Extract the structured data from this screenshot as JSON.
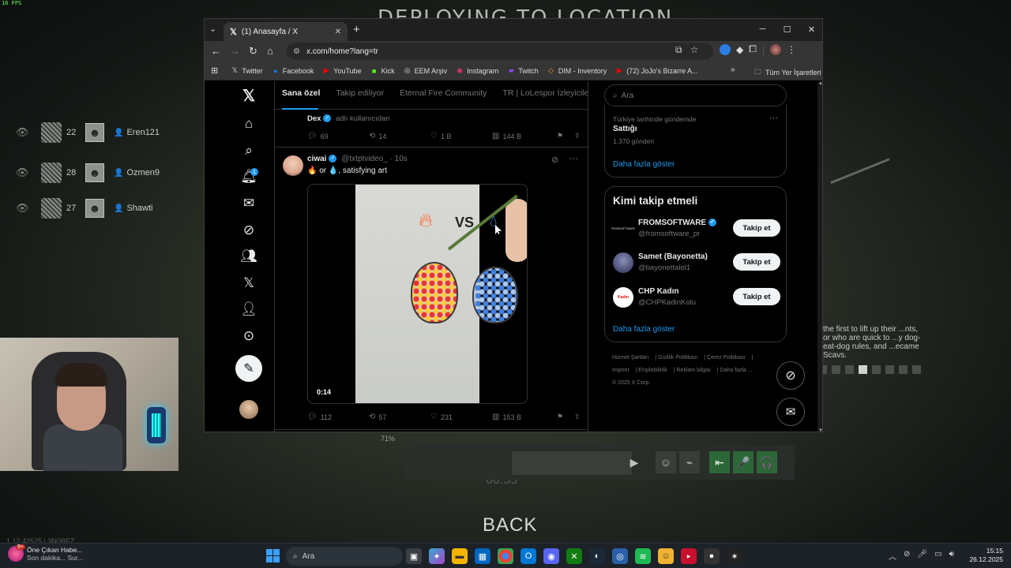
{
  "game": {
    "title": "DEPLOYING TO LOCATION",
    "fps": "16 FPS",
    "back_label": "BACK",
    "timer_ghost": "00:55",
    "squad": [
      {
        "level": "22",
        "name": "Eren121"
      },
      {
        "level": "28",
        "name": "Ozmen9"
      },
      {
        "level": "27",
        "name": "Shawti"
      }
    ],
    "scav_text": "the first to lift up their ...nts, or who are quick to ...y dog-eat-dog rules, and ...ecame Scavs.",
    "voice_pct": "71%",
    "bottom_left_ghost": "1.12.42525 | 3N0RFZ"
  },
  "browser": {
    "tab_title": "(1) Anasayfa / X",
    "url": "x.com/home?lang=tr",
    "bookmarks": [
      {
        "icon": "x-icon",
        "label": "Twitter"
      },
      {
        "icon": "facebook-icon",
        "label": "Facebook"
      },
      {
        "icon": "youtube-icon",
        "label": "YouTube"
      },
      {
        "icon": "kick-icon",
        "label": "Kick"
      },
      {
        "icon": "eem-icon",
        "label": "EEM Arşiv"
      },
      {
        "icon": "instagram-icon",
        "label": "Instagram"
      },
      {
        "icon": "twitch-icon",
        "label": "Twitch"
      },
      {
        "icon": "dim-icon",
        "label": "DIM - Inventory"
      },
      {
        "icon": "youtube-icon",
        "label": "(72) JoJo's Bizarre A..."
      }
    ],
    "all_bookmarks": "Tüm Yer İşaretleri"
  },
  "x": {
    "notification_count": "1",
    "tabs": [
      "Sana özel",
      "Takip ediliyor",
      "Eternal Fire Community",
      "TR | LoLespor İzleyicile"
    ],
    "tweet1": {
      "name": "Dex",
      "from": "adlı kullanıcıdan",
      "replies": "69",
      "reposts": "14",
      "likes": "1 B",
      "views": "144 B"
    },
    "tweet2": {
      "name": "ciwai",
      "handle": "@txtptvideo_",
      "time": "· 10s",
      "text": "🔥 or 💧, satisfying art",
      "video_vs": "VS",
      "duration": "0:14",
      "replies": "112",
      "reposts": "57",
      "likes": "231",
      "views": "153 B"
    },
    "search_placeholder": "Ara",
    "trend": {
      "context": "Türkiye tarihinde gündemde",
      "name": "Sattığı",
      "count": "1.370 gönderi",
      "more": "Daha fazla göster"
    },
    "who_to_follow": {
      "title": "Kimi takip etmeli",
      "items": [
        {
          "name": "FROMSOFTWARE",
          "handle": "@fromsoftware_pr",
          "button": "Takip et",
          "avatar_text": "FROMSOFTWARE"
        },
        {
          "name": "Samet (Bayonetta)",
          "handle": "@bayonettalol1",
          "button": "Takip et",
          "avatar_text": ""
        },
        {
          "name": "CHP Kadın",
          "handle": "@CHPKadinKolu",
          "button": "Takip et",
          "avatar_text": "Kadın"
        }
      ],
      "more": "Daha fazla göster"
    },
    "footer": {
      "row1": [
        "Hizmet Şartları",
        "Gizlilik Politikası",
        "Çerez Politikası"
      ],
      "row2": [
        "Imprint",
        "Erişilebilirlik",
        "Reklam bilgisi",
        "Daha fazla ..."
      ],
      "copyright": "© 2025 X Corp."
    }
  },
  "taskbar": {
    "news_title": "Öne Çıkan Habe...",
    "news_sub": "Son dakika... Sur...",
    "news_badge": "9+",
    "search": "Ara",
    "time": "15:15",
    "date": "26.12.2025"
  },
  "colors": {
    "x_blue": "#1d9bf0",
    "x_bg": "#000000",
    "x_muted": "#71767b"
  }
}
